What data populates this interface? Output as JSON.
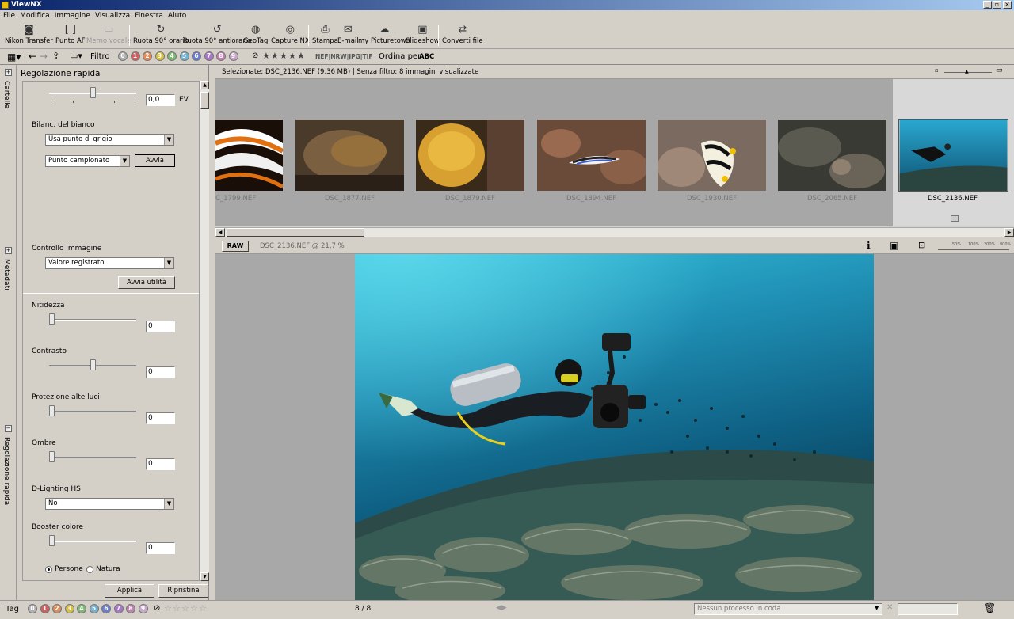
{
  "app": {
    "title": "ViewNX"
  },
  "menu": [
    "File",
    "Modifica",
    "Immagine",
    "Visualizza",
    "Finestra",
    "Aiuto"
  ],
  "toolbar": [
    {
      "label": "Nikon Transfer",
      "icon": "camera-icon",
      "disabled": false
    },
    {
      "label": "Punto AF",
      "icon": "af-point-icon",
      "disabled": false
    },
    {
      "label": "Memo vocale",
      "icon": "voice-memo-icon",
      "disabled": true
    },
    {
      "label": "Ruota 90° orario",
      "icon": "rotate-cw-icon",
      "disabled": false
    },
    {
      "label": "Ruota 90° antiorario",
      "icon": "rotate-ccw-icon",
      "disabled": false
    },
    {
      "label": "GeoTag",
      "icon": "globe-icon",
      "disabled": false
    },
    {
      "label": "Capture NX",
      "icon": "capture-nx-icon",
      "disabled": false
    },
    {
      "label": "Stampa",
      "icon": "printer-icon",
      "disabled": false
    },
    {
      "label": "E-mail",
      "icon": "mail-icon",
      "disabled": false
    },
    {
      "label": "my Picturetown",
      "icon": "picturetown-icon",
      "disabled": false
    },
    {
      "label": "Slideshow",
      "icon": "slideshow-icon",
      "disabled": false
    },
    {
      "label": "Converti file",
      "icon": "convert-icon",
      "disabled": false
    }
  ],
  "toolbar2": {
    "filter_label": "Filtro",
    "labels": [
      "0",
      "1",
      "2",
      "3",
      "4",
      "5",
      "6",
      "7",
      "8",
      "9"
    ],
    "label_colors": [
      "#b0b0b0",
      "#d06060",
      "#e08a5a",
      "#d8c040",
      "#7cb870",
      "#74b0d0",
      "#6c7ccf",
      "#a878c8",
      "#c080b0",
      "#c8a8c8"
    ],
    "formats": "NEF|NRW|JPG|TIF",
    "sort_label": "Ordina per",
    "sort_value": "ABC"
  },
  "left_tabs": [
    "Cartelle",
    "Metadati",
    "Regolazione rapida"
  ],
  "panel": {
    "title": "Regolazione rapida",
    "exposure_value": "0,0",
    "exposure_unit": "EV",
    "wb_label": "Bilanc. del bianco",
    "wb_value": "Usa punto di grigio",
    "sample_value": "Punto campionato",
    "run_button": "Avvia",
    "picture_control_label": "Controllo immagine",
    "picture_control_value": "Valore registrato",
    "utility_button": "Avvia utilità",
    "sharpness_label": "Nitidezza",
    "sharpness_value": "0",
    "contrast_label": "Contrasto",
    "contrast_value": "0",
    "highlight_label": "Protezione alte luci",
    "highlight_value": "0",
    "shadows_label": "Ombre",
    "shadows_value": "0",
    "dlighting_label": "D-Lighting HS",
    "dlighting_value": "No",
    "booster_label": "Booster colore",
    "booster_value": "0",
    "radio_people": "Persone",
    "radio_nature": "Natura",
    "apply_button": "Applica",
    "reset_button": "Ripristina"
  },
  "browser": {
    "info": "Selezionate: DSC_2136.NEF (9,36 MB) | Senza filtro: 8 immagini visualizzate",
    "thumbs": [
      "C_1799.NEF",
      "DSC_1877.NEF",
      "DSC_1879.NEF",
      "DSC_1894.NEF",
      "DSC_1930.NEF",
      "DSC_2065.NEF",
      "DSC_2136.NEF"
    ],
    "selected": "DSC_2136.NEF"
  },
  "viewer": {
    "raw_badge": "RAW",
    "filename": "DSC_2136.NEF @ 21,7 %",
    "zoom_levels": [
      "50%",
      "100%",
      "200%",
      "800%"
    ]
  },
  "status": {
    "tag_label": "Tag",
    "count": "8 / 8",
    "queue": "Nessun processo in coda"
  }
}
